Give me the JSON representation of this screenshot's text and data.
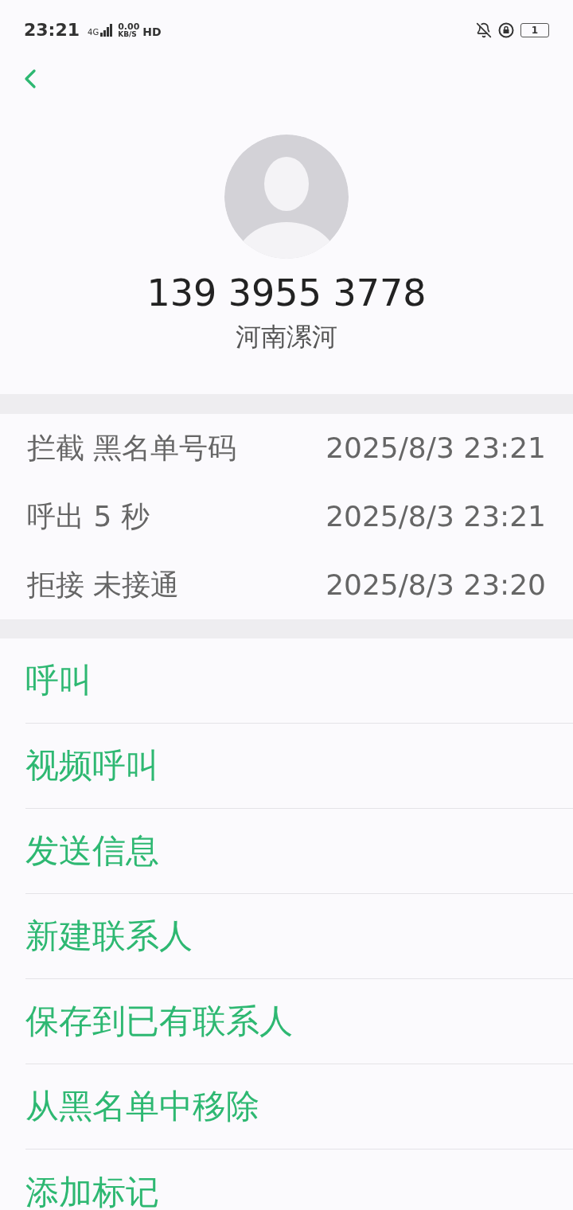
{
  "status_bar": {
    "time": "23:21",
    "network": "4G",
    "speed": "0.00",
    "speed_unit": "KB/S",
    "hd": "HD",
    "battery": "1"
  },
  "contact": {
    "number": "139 3955 3778",
    "location": "河南漯河"
  },
  "call_log": [
    {
      "label": "拦截 黑名单号码",
      "time": "2025/8/3 23:21"
    },
    {
      "label": "呼出 5 秒",
      "time": "2025/8/3 23:21"
    },
    {
      "label": "拒接 未接通",
      "time": "2025/8/3 23:20"
    }
  ],
  "actions": [
    "呼叫",
    "视频呼叫",
    "发送信息",
    "新建联系人",
    "保存到已有联系人",
    "从黑名单中移除",
    "添加标记"
  ]
}
